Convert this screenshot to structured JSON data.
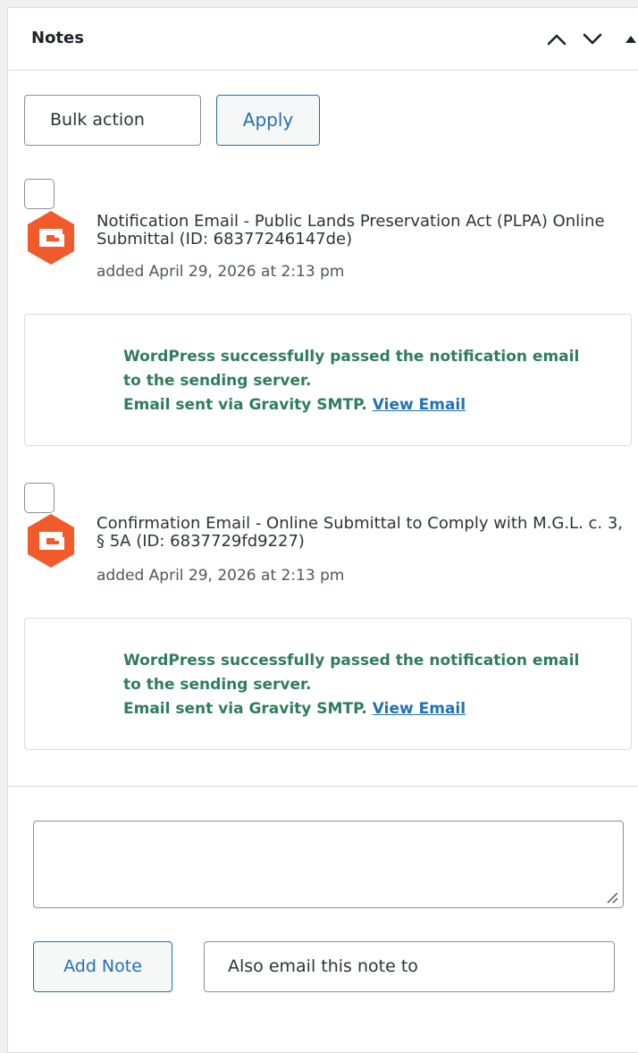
{
  "panel": {
    "title": "Notes"
  },
  "header_buttons": {
    "up_icon": "chevron-up-icon",
    "down_icon": "chevron-down-icon",
    "toggle_icon": "triangle-up-icon"
  },
  "bulk": {
    "select_label": "Bulk action",
    "apply_label": "Apply"
  },
  "notes": [
    {
      "title": "Notification Email - Public Lands Preservation Act (PLPA) Online Submittal (ID: 68377246147de)",
      "date": "added April 29, 2026 at 2:13 pm",
      "icon": "gravity-forms-icon",
      "message_line1": "WordPress successfully passed the notification email",
      "message_line2": "to the sending server.",
      "message_line3": "Email sent via Gravity SMTP.",
      "link_label": "View Email"
    },
    {
      "title": "Confirmation Email - Online Submittal to Comply with M.G.L. c. 3, § 5A (ID: 6837729fd9227)",
      "date": "added April 29, 2026 at 2:13 pm",
      "icon": "gravity-forms-icon",
      "message_line1": "WordPress successfully passed the notification email",
      "message_line2": "to the sending server.",
      "message_line3": "Email sent via Gravity SMTP.",
      "link_label": "View Email"
    }
  ],
  "add_note": {
    "textarea_value": "",
    "button_label": "Add Note",
    "email_select_label": "Also email this note to"
  },
  "colors": {
    "accent": "#2271b1",
    "success_text": "#2e7d5b",
    "gravity_orange": "#f15a2b"
  }
}
